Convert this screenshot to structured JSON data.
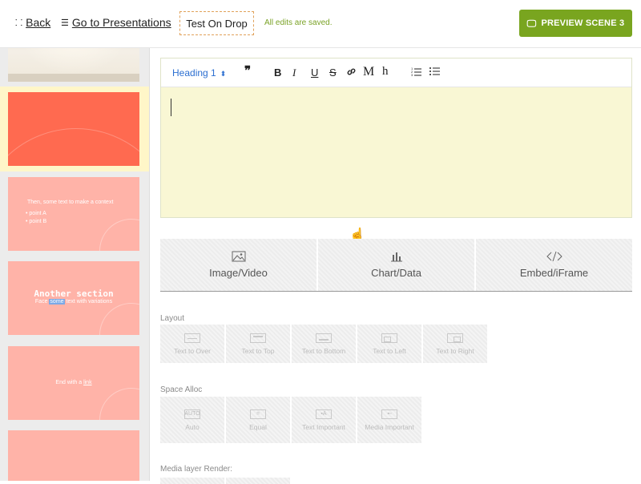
{
  "header": {
    "back_label": "Back",
    "presentations_label": "Go to Presentations",
    "title_value": "Test On Drop",
    "status": "All edits are saved.",
    "preview_label": "PREVIEW SCENE 3",
    "accent_color": "#79a51f"
  },
  "sidebar": {
    "slides": [
      {
        "kind": "image"
      },
      {
        "kind": "solid",
        "color": "#ff6a50",
        "active": true
      },
      {
        "text": "Then, some text to make a context",
        "points": [
          "point A",
          "point B"
        ]
      },
      {
        "heading": "Another section",
        "sub_before": "Face",
        "sub_highlight": "some",
        "sub_after": "text with variations"
      },
      {
        "text_before": "End with a",
        "link": "link"
      },
      {
        "kind": "blank"
      }
    ]
  },
  "editor": {
    "heading_select": "Heading 1",
    "tools": {
      "quote": "❞",
      "bold": "B",
      "italic": "I",
      "underline": "U",
      "strike": "S",
      "m": "M",
      "h": "h"
    }
  },
  "media": {
    "buttons": [
      {
        "label": "Image/Video",
        "icon": "image-icon"
      },
      {
        "label": "Chart/Data",
        "icon": "chart-icon"
      },
      {
        "label": "Embed/iFrame",
        "icon": "code-icon"
      }
    ]
  },
  "layout": {
    "label": "Layout",
    "options": [
      "Text to Over",
      "Text to Top",
      "Text to Bottom",
      "Text to Left",
      "Text to Right"
    ]
  },
  "space_alloc": {
    "label": "Space Alloc",
    "options": [
      "Auto",
      "Equal",
      "Text Important",
      "Media Important"
    ],
    "icons": [
      "AUTO",
      "=",
      "▪A",
      "▪▫"
    ]
  },
  "media_layer": {
    "label": "Media layer Render:"
  }
}
